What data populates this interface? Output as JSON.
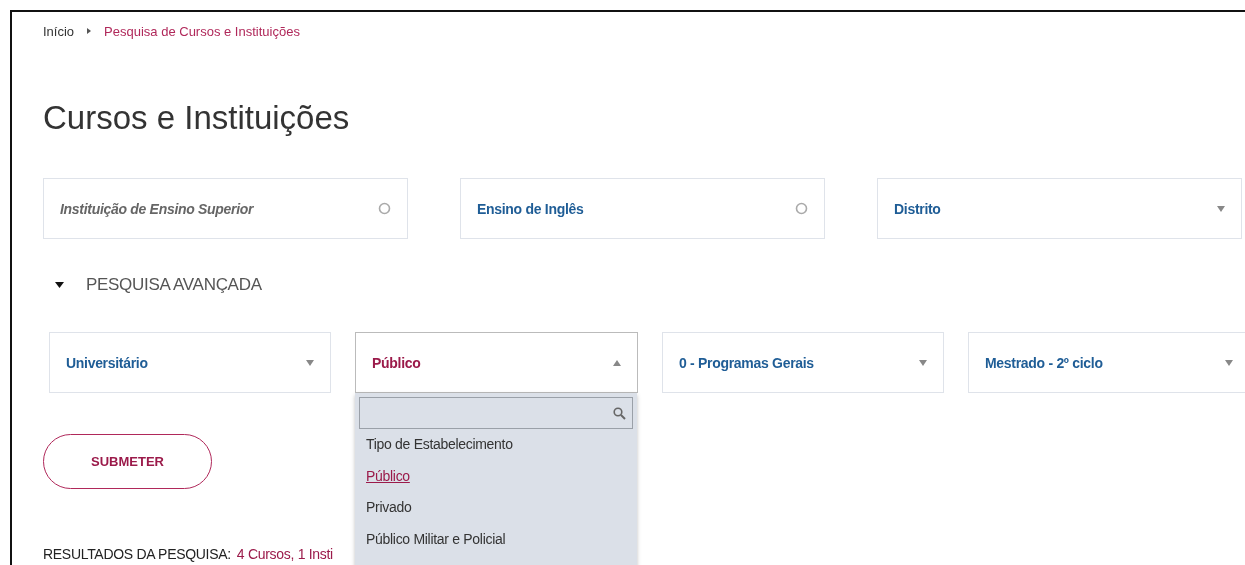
{
  "breadcrumb": [
    {
      "label": "Início",
      "current": false
    },
    {
      "label": "Pesquisa de Cursos e Instituições",
      "current": true
    }
  ],
  "title": "Cursos e Instituições",
  "filters": [
    {
      "kind": "search",
      "placeholder": "Instituição de Ensino Superior"
    },
    {
      "kind": "search",
      "value": "Ensino de Inglês"
    },
    {
      "kind": "select",
      "value": "Distrito",
      "expanded": false
    }
  ],
  "advanced": {
    "label": "PESQUISA AVANÇADA",
    "expanded": true,
    "filters": [
      {
        "kind": "select",
        "value": "Universitário",
        "expanded": false
      },
      {
        "kind": "select",
        "value": "Público",
        "expanded": true
      },
      {
        "kind": "select",
        "value": "0 - Programas Gerais",
        "expanded": false
      },
      {
        "kind": "select",
        "value": "Mestrado - 2º ciclo",
        "expanded": false
      }
    ]
  },
  "dropdown": {
    "options": [
      {
        "label": "Tipo de Estabelecimento",
        "selected": false
      },
      {
        "label": "Público",
        "selected": true
      },
      {
        "label": "Privado",
        "selected": false
      },
      {
        "label": "Público Militar e Policial",
        "selected": false
      }
    ]
  },
  "submit": "SUBMETER",
  "results": {
    "label": "RESULTADOS DA PESQUISA:",
    "summary": "4 Cursos, 1 Insti"
  }
}
